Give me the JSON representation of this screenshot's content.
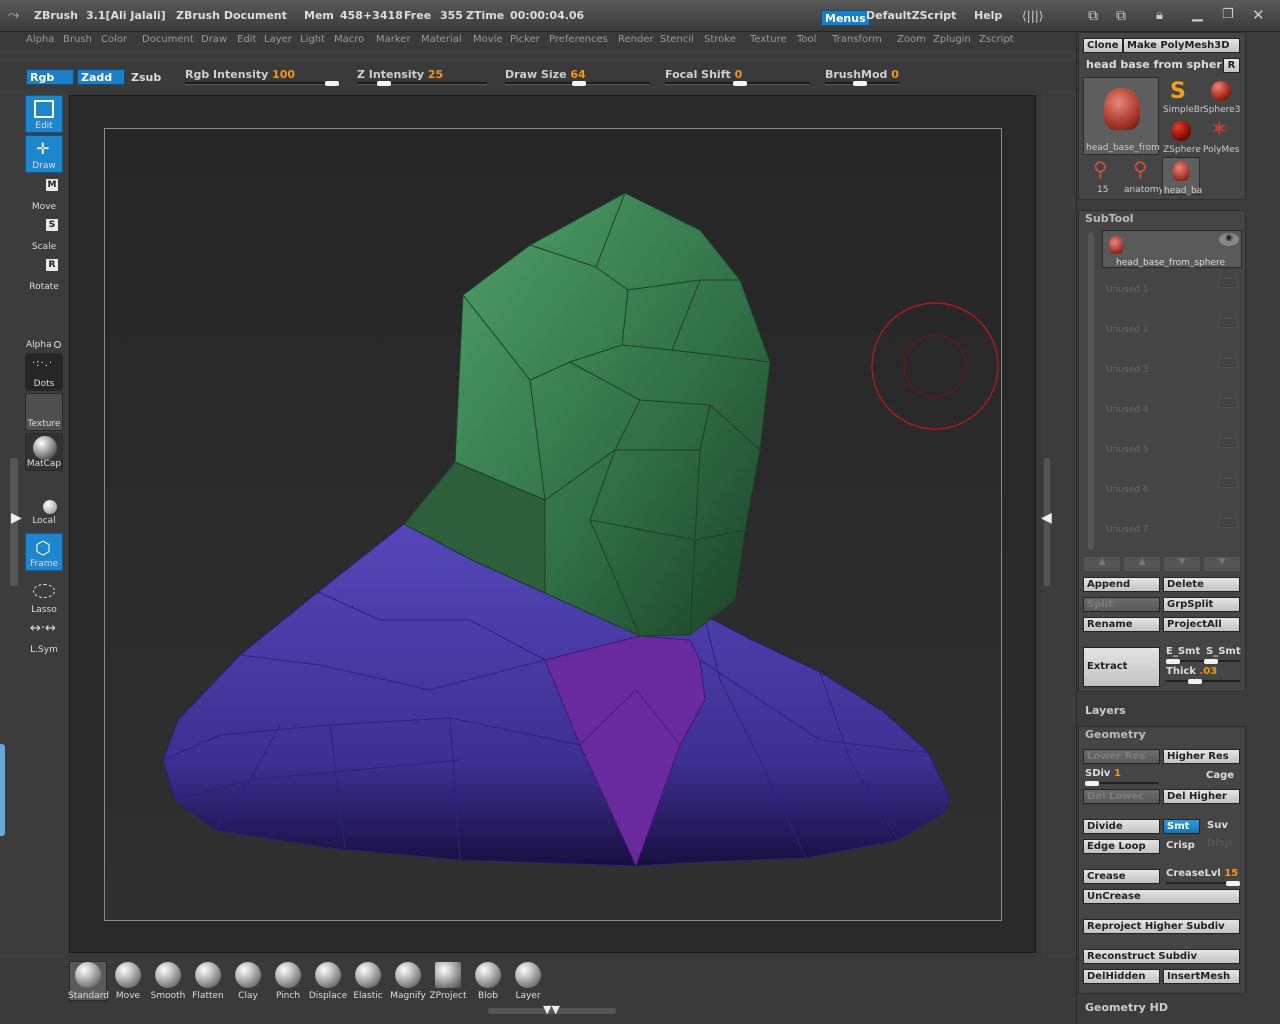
{
  "titlebar": {
    "app": "ZBrush",
    "version": "3.1[Ali Jalali]",
    "document": "ZBrush Document",
    "mem_label": "Mem",
    "mem_value": "458+3418",
    "free_label": "Free",
    "free_value": "355",
    "ztime_label": "ZTime",
    "ztime_value": "00:00:04.06",
    "menus_btn": "Menus",
    "zscript": "DefaultZScript",
    "help": "Help"
  },
  "menubar": [
    "Alpha",
    "Brush",
    "Color",
    "Document",
    "Draw",
    "Edit",
    "Layer",
    "Light",
    "Macro",
    "Marker",
    "Material",
    "Movie",
    "Picker",
    "Preferences",
    "Render",
    "Stencil",
    "Stroke",
    "Texture",
    "Tool",
    "Transform",
    "Zoom",
    "Zplugin",
    "Zscript"
  ],
  "topbar": {
    "rgb": "Rgb",
    "zadd": "Zadd",
    "zsub": "Zsub",
    "rgb_intensity_label": "Rgb Intensity",
    "rgb_intensity_value": "100",
    "z_intensity_label": "Z Intensity",
    "z_intensity_value": "25",
    "draw_size_label": "Draw Size",
    "draw_size_value": "64",
    "focal_shift_label": "Focal Shift",
    "focal_shift_value": "0",
    "brushmod_label": "BrushMod",
    "brushmod_value": "0"
  },
  "leftshelf": {
    "edit": "Edit",
    "draw": "Draw",
    "move": "Move",
    "move_key": "M",
    "scale": "Scale",
    "scale_key": "S",
    "rotate": "Rotate",
    "rotate_key": "R",
    "alpha": "Alpha",
    "dots": "Dots",
    "texture": "Texture",
    "matcap": "MatCap",
    "local": "Local",
    "frame": "Frame",
    "lasso": "Lasso",
    "lsym": "L.Sym"
  },
  "bottomshelf": [
    "Standard",
    "Move",
    "Smooth",
    "Flatten",
    "Clay",
    "Pinch",
    "Displace",
    "Elastic",
    "Magnify",
    "ZProject",
    "Blob",
    "Layer"
  ],
  "tool": {
    "clone": "Clone",
    "make_polymesh": "Make PolyMesh3D",
    "current_tool": "head base from spher",
    "r_btn": "R",
    "thumbs": [
      "SimpleBr",
      "Sphere3",
      "ZSphere",
      "PolyMes",
      "15",
      "anatomy",
      "head_ba"
    ],
    "big_thumb_label": "head_base_from"
  },
  "subtool": {
    "title": "SubTool",
    "item0": "head_base_from_sphere",
    "unused": [
      "Unused 1",
      "Unused 2",
      "Unused 3",
      "Unused 4",
      "Unused 5",
      "Unused 6",
      "Unused 7"
    ],
    "append": "Append",
    "delete": "Delete",
    "split": "Split",
    "grpsplit": "GrpSplit",
    "rename": "Rename",
    "projectall": "ProjectAll",
    "extract": "Extract",
    "e_smt": "E_Smt",
    "s_smt": "S_Smt",
    "thick_label": "Thick",
    "thick_value": ".03"
  },
  "layers": {
    "title": "Layers"
  },
  "geometry": {
    "title": "Geometry",
    "lower_res": "Lower Res",
    "higher_res": "Higher Res",
    "sdiv_label": "SDiv",
    "sdiv_value": "1",
    "cage": "Cage",
    "del_lower": "Del Lower",
    "del_higher": "Del Higher",
    "divide": "Divide",
    "smt": "Smt",
    "suv": "Suv",
    "edge_loop": "Edge Loop",
    "crisp": "Crisp",
    "disp": "Disp",
    "crease": "Crease",
    "creaselvl_label": "CreaseLvl",
    "creaselvl_value": "15",
    "uncrease": "UnCrease",
    "reproject": "Reproject Higher Subdiv",
    "reconstruct": "Reconstruct Subdiv",
    "delhidden": "DelHidden",
    "insertmesh": "InsertMesh"
  },
  "geometry_hd": {
    "title": "Geometry HD"
  },
  "colors": {
    "accent": "#1d7ec4",
    "slider_value": "#f0961e",
    "head_polygroup": "#3f8a55",
    "torso_polygroup": "#4a3aa8",
    "chest_polygroup": "#6a2aa0",
    "brush_cursor": "#c01818"
  }
}
